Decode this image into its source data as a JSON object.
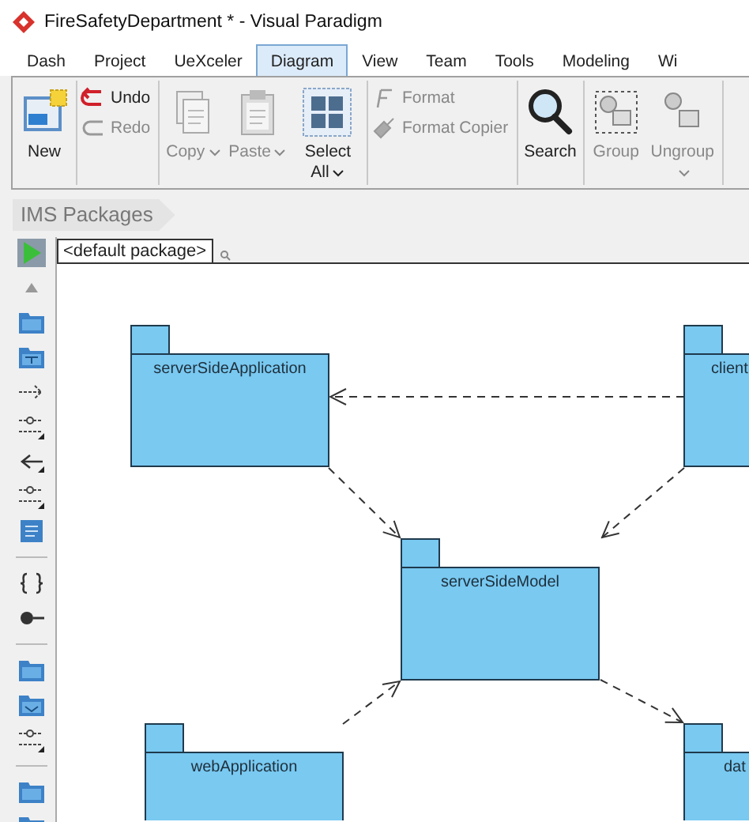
{
  "window": {
    "title": "FireSafetyDepartment * - Visual Paradigm"
  },
  "tabs": [
    {
      "label": "Dash",
      "selected": false
    },
    {
      "label": "Project",
      "selected": false
    },
    {
      "label": "UeXceler",
      "selected": false
    },
    {
      "label": "Diagram",
      "selected": true
    },
    {
      "label": "View",
      "selected": false
    },
    {
      "label": "Team",
      "selected": false
    },
    {
      "label": "Tools",
      "selected": false
    },
    {
      "label": "Modeling",
      "selected": false
    },
    {
      "label": "Wi",
      "selected": false
    }
  ],
  "ribbon": [
    {
      "buttons": [
        {
          "kind": "large",
          "label": "New",
          "disabled": false,
          "dropdown": false
        }
      ]
    },
    {
      "buttons": [
        {
          "kind": "small",
          "label": "Undo",
          "disabled": false
        },
        {
          "kind": "small",
          "label": "Redo",
          "disabled": true
        }
      ]
    },
    {
      "buttons": [
        {
          "kind": "large",
          "label": "Copy",
          "disabled": true,
          "dropdown": true
        },
        {
          "kind": "large",
          "label": "Paste",
          "disabled": true,
          "dropdown": true
        },
        {
          "kind": "large",
          "label": "Select All",
          "disabled": false,
          "dropdown": true
        }
      ]
    },
    {
      "buttons": [
        {
          "kind": "small",
          "label": "Format",
          "disabled": true
        },
        {
          "kind": "small",
          "label": "Format Copier",
          "disabled": true
        }
      ]
    },
    {
      "buttons": [
        {
          "kind": "large",
          "label": "Search",
          "disabled": false,
          "dropdown": false
        }
      ]
    },
    {
      "buttons": [
        {
          "kind": "large",
          "label": "Group",
          "disabled": true,
          "dropdown": false
        },
        {
          "kind": "large",
          "label": "Ungroup",
          "disabled": true,
          "dropdown": true
        }
      ]
    }
  ],
  "breadcrumb": [
    "IMS Packages"
  ],
  "palette": [
    {
      "kind": "pointer",
      "selected": true
    },
    {
      "kind": "scroll-up",
      "selected": false
    },
    {
      "kind": "package",
      "selected": false
    },
    {
      "kind": "subsystem",
      "selected": false
    },
    {
      "kind": "dependency",
      "selected": false
    },
    {
      "kind": "tagged",
      "selected": false
    },
    {
      "kind": "generalization",
      "selected": false
    },
    {
      "kind": "tagged",
      "selected": false
    },
    {
      "kind": "note",
      "selected": false
    },
    {
      "kind": "separator"
    },
    {
      "kind": "constraint",
      "selected": false
    },
    {
      "kind": "interface",
      "selected": false
    },
    {
      "kind": "separator"
    },
    {
      "kind": "package",
      "selected": false
    },
    {
      "kind": "model",
      "selected": false
    },
    {
      "kind": "tagged",
      "selected": false
    },
    {
      "kind": "separator"
    },
    {
      "kind": "package",
      "selected": false
    },
    {
      "kind": "package",
      "selected": false
    }
  ],
  "diagram": {
    "package_tab": "<default package>",
    "packages": [
      {
        "name": "serverSideApplication"
      },
      {
        "name": "client"
      },
      {
        "name": "serverSideModel"
      },
      {
        "name": "webApplication"
      },
      {
        "name": "dat"
      }
    ]
  }
}
